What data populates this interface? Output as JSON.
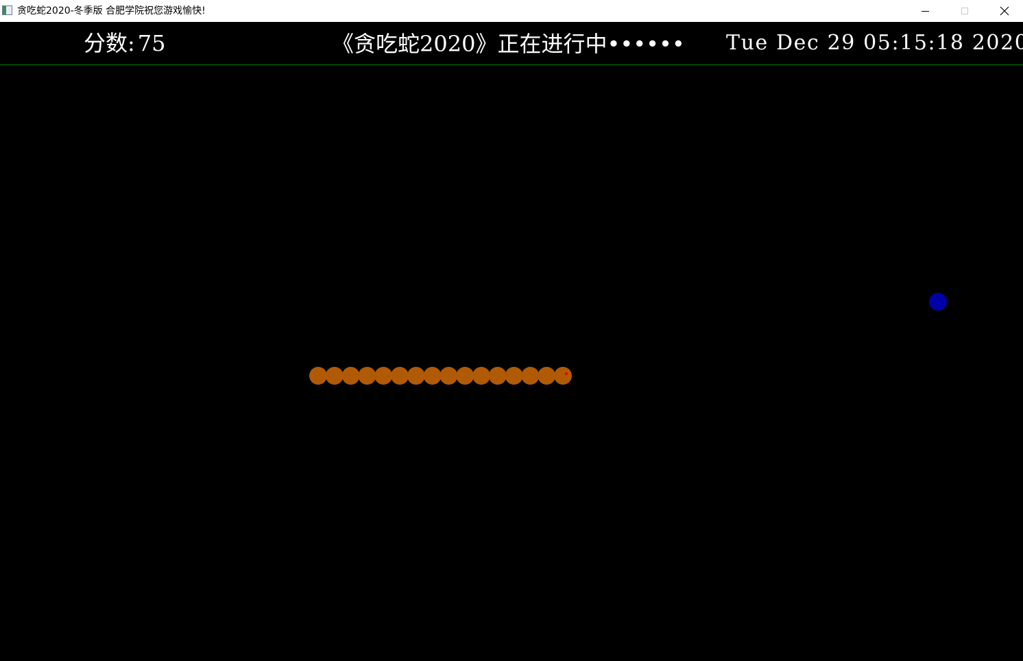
{
  "window": {
    "title": "贪吃蛇2020-冬季版 合肥学院祝您游戏愉快!"
  },
  "hud": {
    "score_label": "分数:",
    "score_value": "75",
    "status_text": "《贪吃蛇2020》正在进行中••••••",
    "clock": "Tue Dec 29 05:15:18 2020",
    "divider_color": "#008000"
  },
  "game": {
    "background_color": "#000000",
    "snake": {
      "color": "#b05a06",
      "eye_color": "#ff0000",
      "length": 16,
      "direction": "right"
    },
    "food": {
      "color": "#0000a8"
    }
  },
  "icons": {
    "app": "app-icon",
    "minimize": "minimize-icon",
    "maximize": "maximize-icon",
    "close": "close-icon"
  }
}
